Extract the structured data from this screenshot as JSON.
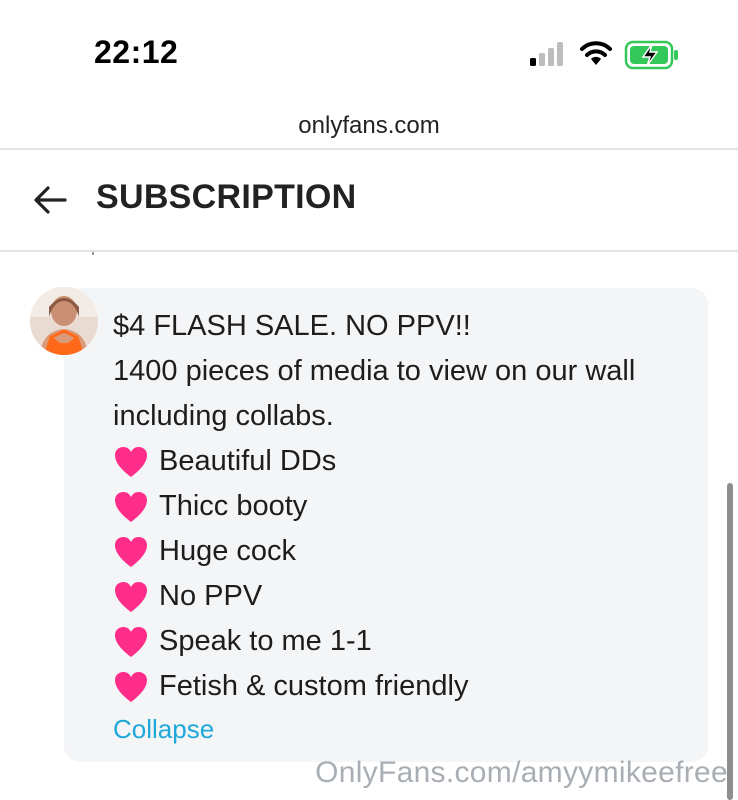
{
  "status_bar": {
    "time": "22:12",
    "signal_icon": "cellular-signal-icon",
    "wifi_icon": "wifi-icon",
    "battery_icon": "battery-charging-icon",
    "battery_color": "#34c759"
  },
  "browser": {
    "url": "onlyfans.com"
  },
  "header": {
    "back_icon": "arrow-left-icon",
    "title": "SUBSCRIPTION"
  },
  "message": {
    "avatar_icon": "user-avatar",
    "lines": [
      "$4 FLASH SALE. NO PPV!!",
      "1400 pieces of media to view on our wall",
      "including collabs."
    ],
    "heart_icon": "pink-heart-icon",
    "heart_color": "#ff2d8a",
    "bullets": [
      "Beautiful DDs",
      "Thicc booty",
      "Huge cock",
      "No PPV",
      "Speak to me 1-1",
      "Fetish & custom friendly"
    ],
    "collapse_label": "Collapse",
    "link_color": "#1fa8d8"
  },
  "watermark": "OnlyFans.com/amyymikeefree"
}
